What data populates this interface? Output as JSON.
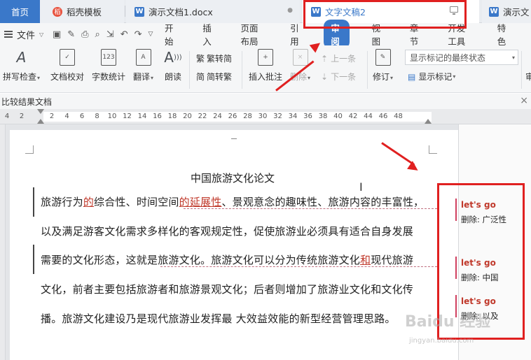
{
  "tabs": {
    "home": "首页",
    "template": "稻壳模板",
    "doc1": "演示文档1.docx",
    "doc2": "文字文稿2",
    "doc3": "演示文"
  },
  "menubar": {
    "file": "文件",
    "items": [
      "开始",
      "插入",
      "页面布局",
      "引用",
      "审阅",
      "视图",
      "章节",
      "开发工具",
      "特色"
    ],
    "active_index": 4
  },
  "ribbon": {
    "spell_check": "拼写检查",
    "doc_proof": "文档校对",
    "word_count": "字数统计",
    "translate": "翻译",
    "read_aloud": "朗读",
    "to_traditional": "繁转简",
    "to_simplified": "简转繁",
    "insert_comment": "插入批注",
    "delete": "删除",
    "prev": "上一条",
    "next": "下一条",
    "revise": "修订",
    "markup_state": "显示标记的最终状态",
    "show_markup": "显示标记",
    "cut_off": "审"
  },
  "compare_title": "比较结果文档",
  "ruler": {
    "numbers": [
      "4",
      "2",
      "2",
      "4",
      "6",
      "8",
      "10",
      "12",
      "14",
      "16",
      "18",
      "20",
      "22",
      "24",
      "26",
      "28",
      "30",
      "32",
      "34",
      "36",
      "38",
      "40",
      "42",
      "44",
      "46",
      "48"
    ]
  },
  "document": {
    "title": "中国旅游文化论文",
    "line1": {
      "a": "旅游行为",
      "ins1": "的",
      "b": "综合性、时间空间",
      "ins2": "的延展性",
      "c": "、景观意念的趣味性、旅游内容的丰富性，"
    },
    "line2": "以及满足游客文化需求多样化的客观规定性，促使旅游业必须具有适合自身发展",
    "line3": {
      "a": "需要的文化形态，这就是旅游文化。旅游文化可以分为传统旅游文化",
      "ins": "和",
      "b": "现代旅游"
    },
    "line4": "文化，前者主要包括旅游者和旅游景观文化；后者则增加了旅游业文化和文化传",
    "line5": "播。旅游文化建设乃是现代旅游业发挥最 大效益效能的新型经营管理思路。"
  },
  "markup_notes": [
    {
      "author": "let's go",
      "text": "删除: 广泛性"
    },
    {
      "author": "let's go",
      "text": "删除: 中国"
    },
    {
      "author": "let's go",
      "text": "删除: 以及"
    }
  ],
  "watermark": {
    "main": "Baidu 经验",
    "sub": "jingyan.baidu.com"
  },
  "colors": {
    "accent": "#3a78c9",
    "revision": "#c0392b",
    "annotation": "#e02020"
  }
}
